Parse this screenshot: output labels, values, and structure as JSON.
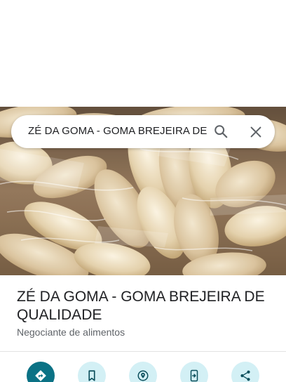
{
  "search": {
    "query": "ZÉ DA GOMA - GOMA BREJEIRA DE"
  },
  "place": {
    "title": "ZÉ DA GOMA - GOMA BREJEIRA DE QUALIDADE",
    "category": "Negociante de alimentos"
  },
  "actions": [
    {
      "icon": "directions-icon",
      "primary": true
    },
    {
      "icon": "bookmark-icon",
      "primary": false
    },
    {
      "icon": "location-pin-icon",
      "primary": false
    },
    {
      "icon": "send-to-phone-icon",
      "primary": false
    },
    {
      "icon": "share-icon",
      "primary": false
    }
  ],
  "colors": {
    "primary_action": "#0b7285",
    "secondary_action": "#d3f0f5",
    "title_text": "#202124",
    "category_text": "#5f6368"
  }
}
